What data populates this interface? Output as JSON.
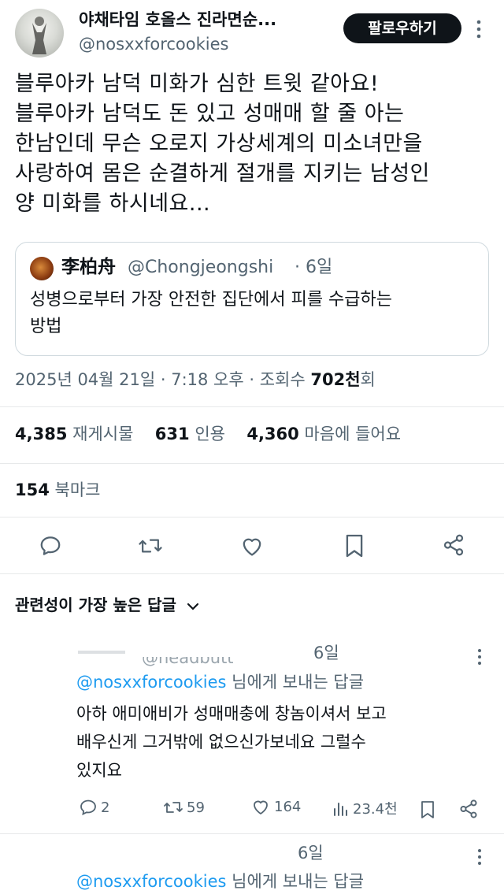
{
  "header": {
    "display_name": "야채타임 호올스 진라면순...",
    "handle": "@nosxxforcookies",
    "follow_label": "팔로우하기"
  },
  "tweet": {
    "lines": [
      "블루아카 남덕 미화가 심한 트윗 같아요!",
      "블루아카 남덕도 돈 있고 성매매 할 줄 아는",
      "한남인데 무슨 오로지 가상세계의 미소녀만을",
      "사랑하여 몸은 순결하게 절개를 지키는 남성인",
      "양 미화를 하시네요..."
    ]
  },
  "quote": {
    "name": "李柏舟",
    "handle": "@Chongjeongshi",
    "time": "· 6일",
    "lines": [
      "성병으로부터 가장 안전한 집단에서 피를 수급하는",
      "방법"
    ]
  },
  "meta": {
    "timestamp": "2025년 04월 21일 · 7:18 오후 · 조회수",
    "views": "702천",
    "views_suffix": "회"
  },
  "stats": {
    "retweets": "4,385",
    "retweets_label": "재게시물",
    "quotes": "631",
    "quotes_label": "인용",
    "likes": "4,360",
    "likes_label": "마음에 들어요",
    "bookmarks": "154",
    "bookmarks_label": "북마크"
  },
  "actions": [
    "reply-icon",
    "retweet-icon",
    "like-icon",
    "bookmark-icon",
    "share-icon"
  ],
  "sort_label": "관련성이 가장 높은 답글",
  "replies": [
    {
      "name_partial": "@headbutt",
      "time": "6일",
      "to_handle": "@nosxxforcookies",
      "to_suffix": "님에게 보내는 답글",
      "lines": [
        "아하 애미애비가 성매매충에 창놈이셔서 보고",
        "배우신게 그거밖에 없으신가보네요 그럴수",
        "있지요"
      ],
      "replies_count": "2",
      "retweets_count": "59",
      "likes_count": "164",
      "views_count": "23.4천"
    },
    {
      "time": "6일",
      "to_handle": "@nosxxforcookies",
      "to_suffix": "님에게 보내는 답글"
    }
  ]
}
